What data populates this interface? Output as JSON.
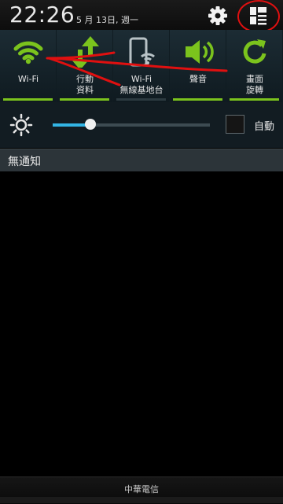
{
  "status": {
    "time": "22:26",
    "date": "5 月 13日, 週一"
  },
  "icons": {
    "settings": "gear-icon",
    "edit": "quick-settings-grid-icon",
    "brightness": "brightness-sun-icon"
  },
  "toggles": [
    {
      "id": "wifi",
      "label": "Wi-Fi",
      "icon": "wifi-icon",
      "on": true
    },
    {
      "id": "mobile-data",
      "label": "行動\n資料",
      "icon": "mobile-data-icon",
      "on": true
    },
    {
      "id": "hotspot",
      "label": "Wi-Fi\n無線基地台",
      "icon": "hotspot-icon",
      "on": false
    },
    {
      "id": "sound",
      "label": "聲音",
      "icon": "speaker-icon",
      "on": true
    },
    {
      "id": "rotation",
      "label": "畫面\n旋轉",
      "icon": "rotate-icon",
      "on": true
    }
  ],
  "brightness": {
    "level": 0.24,
    "auto_label": "自動",
    "auto_checked": false
  },
  "notifications": {
    "header": "無通知"
  },
  "carrier": "中華電信",
  "colors": {
    "active": "#7bc31d",
    "slider": "#33b5e5",
    "annotation": "#e01010"
  }
}
